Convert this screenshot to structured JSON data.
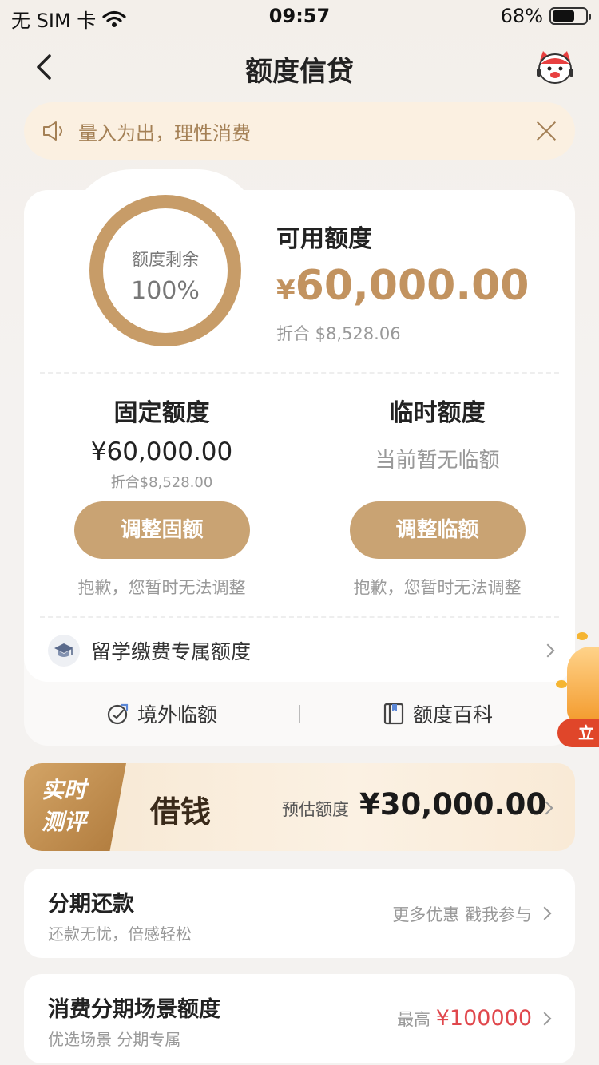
{
  "status_bar": {
    "carrier": "无 SIM 卡",
    "time": "09:57",
    "battery": "68%",
    "battery_level": 0.68
  },
  "nav": {
    "title": "额度信贷"
  },
  "notice": {
    "text": "量入为出，理性消费"
  },
  "credit": {
    "ring_label": "额度剩余",
    "ring_value": "100%",
    "available_title": "可用额度",
    "available_yen": "¥",
    "available_amount": "60,000.00",
    "available_conversion": "折合  $8,528.06",
    "fixed": {
      "title": "固定额度",
      "amount": "¥60,000.00",
      "conversion": "折合$8,528.00",
      "button": "调整固额",
      "hint": "抱歉，您暂时无法调整"
    },
    "temporary": {
      "title": "临时额度",
      "none_text": "当前暂无临额",
      "button": "调整临额",
      "hint": "抱歉，您暂时无法调整"
    },
    "study_abroad": "留学缴费专属额度",
    "links": {
      "overseas": "境外临额",
      "encyclopedia": "额度百科"
    }
  },
  "side_promo": {
    "button": "立"
  },
  "borrow": {
    "tag": "实时测评",
    "title": "借钱",
    "estimate_label": "预估额度",
    "estimate_amount": "¥30,000.00"
  },
  "installment": {
    "title": "分期还款",
    "subtitle": "还款无忧，倍感轻松",
    "right_text": "更多优惠 戳我参与"
  },
  "scene": {
    "title": "消费分期场景额度",
    "subtitle": "优选场景 分期专属",
    "right_prefix": "最高 ",
    "right_amount": "¥100000"
  },
  "colors": {
    "accent": "#c9a373",
    "ring": "#c79c68",
    "price_red": "#e0474c",
    "notice_bg": "#fbf0e1"
  }
}
